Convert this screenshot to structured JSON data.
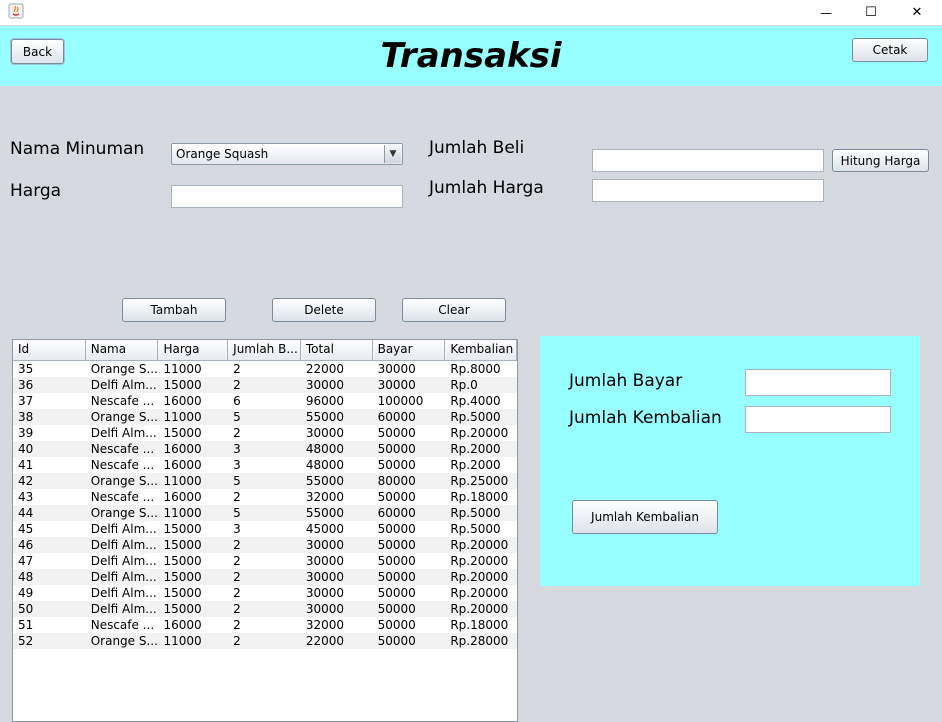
{
  "window": {
    "minimize_glyph": "—",
    "maximize_glyph": "☐",
    "close_glyph": "✕"
  },
  "header": {
    "title": "Transaksi",
    "back_label": "Back",
    "cetak_label": "Cetak"
  },
  "form": {
    "nama_minuman_label": "Nama Minuman",
    "nama_minuman_selected": "Orange Squash",
    "harga_label": "Harga",
    "harga_value": "",
    "jumlah_beli_label": "Jumlah Beli",
    "jumlah_beli_value": "",
    "jumlah_harga_label": "Jumlah Harga",
    "jumlah_harga_value": "",
    "hitung_harga_label": "Hitung Harga"
  },
  "actions": {
    "tambah_label": "Tambah",
    "delete_label": "Delete",
    "clear_label": "Clear"
  },
  "table": {
    "columns": [
      "Id",
      "Nama",
      "Harga",
      "Jumlah B...",
      "Total",
      "Bayar",
      "Kembalian"
    ],
    "rows": [
      [
        "35",
        "Orange S...",
        "11000",
        "2",
        "22000",
        "30000",
        "Rp.8000"
      ],
      [
        "36",
        "Delfi Alm...",
        "15000",
        "2",
        "30000",
        "30000",
        "Rp.0"
      ],
      [
        "37",
        "Nescafe ...",
        "16000",
        "6",
        "96000",
        "100000",
        "Rp.4000"
      ],
      [
        "38",
        "Orange S...",
        "11000",
        "5",
        "55000",
        "60000",
        "Rp.5000"
      ],
      [
        "39",
        "Delfi Alm...",
        "15000",
        "2",
        "30000",
        "50000",
        "Rp.20000"
      ],
      [
        "40",
        "Nescafe ...",
        "16000",
        "3",
        "48000",
        "50000",
        "Rp.2000"
      ],
      [
        "41",
        "Nescafe ...",
        "16000",
        "3",
        "48000",
        "50000",
        "Rp.2000"
      ],
      [
        "42",
        "Orange S...",
        "11000",
        "5",
        "55000",
        "80000",
        "Rp.25000"
      ],
      [
        "43",
        "Nescafe ...",
        "16000",
        "2",
        "32000",
        "50000",
        "Rp.18000"
      ],
      [
        "44",
        "Orange S...",
        "11000",
        "5",
        "55000",
        "60000",
        "Rp.5000"
      ],
      [
        "45",
        "Delfi Alm...",
        "15000",
        "3",
        "45000",
        "50000",
        "Rp.5000"
      ],
      [
        "46",
        "Delfi Alm...",
        "15000",
        "2",
        "30000",
        "50000",
        "Rp.20000"
      ],
      [
        "47",
        "Delfi Alm...",
        "15000",
        "2",
        "30000",
        "50000",
        "Rp.20000"
      ],
      [
        "48",
        "Delfi Alm...",
        "15000",
        "2",
        "30000",
        "50000",
        "Rp.20000"
      ],
      [
        "49",
        "Delfi Alm...",
        "15000",
        "2",
        "30000",
        "50000",
        "Rp.20000"
      ],
      [
        "50",
        "Delfi Alm...",
        "15000",
        "2",
        "30000",
        "50000",
        "Rp.20000"
      ],
      [
        "51",
        "Nescafe ...",
        "16000",
        "2",
        "32000",
        "50000",
        "Rp.18000"
      ],
      [
        "52",
        "Orange S...",
        "11000",
        "2",
        "22000",
        "50000",
        "Rp.28000"
      ]
    ]
  },
  "payment": {
    "jumlah_bayar_label": "Jumlah Bayar",
    "jumlah_bayar_value": "",
    "jumlah_kembalian_label": "Jumlah Kembalian",
    "jumlah_kembalian_value": "",
    "jumlah_kembalian_button": "Jumlah Kembalian"
  },
  "colors": {
    "accent": "#97ffff",
    "background": "#d6d9df"
  }
}
